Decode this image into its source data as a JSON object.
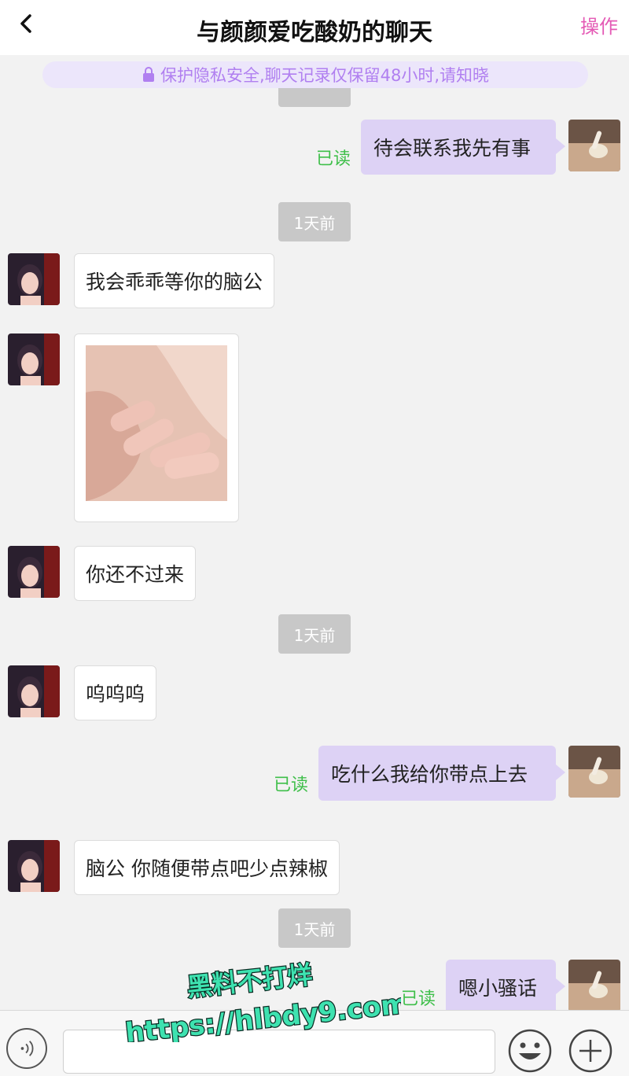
{
  "header": {
    "title": "与颜颜爱吃酸奶的聊天",
    "action_label": "操作"
  },
  "privacy_notice": "保护隐私安全,聊天记录仅保留48小时,请知晓",
  "messages": [
    {
      "side": "out",
      "text": "待会联系我先有事",
      "status": "已读"
    },
    {
      "time": "1天前"
    },
    {
      "side": "in",
      "text": "我会乖乖等你的脑公"
    },
    {
      "side": "in",
      "type": "image"
    },
    {
      "side": "in",
      "text": "你还不过来"
    },
    {
      "time": "1天前"
    },
    {
      "side": "in",
      "text": "呜呜呜"
    },
    {
      "side": "out",
      "text": "吃什么我给你带点上去",
      "status": "已读"
    },
    {
      "side": "in",
      "text": "脑公 你随便带点吧少点辣椒"
    },
    {
      "time": "1天前"
    },
    {
      "side": "out",
      "text": "嗯小骚话",
      "status": "已读"
    }
  ],
  "watermark": {
    "line1": "黑料不打烊",
    "line2": "https://hlbdy9.com"
  },
  "colors": {
    "accent": "#e45ab5",
    "outgoing_bubble": "#ddd2f5",
    "read_status": "#3fbf4a",
    "banner_bg": "#ece6fb"
  },
  "icons": {
    "back": "chevron-left-icon",
    "lock": "lock-icon",
    "voice": "voice-icon",
    "emoji": "emoji-icon",
    "more": "plus-icon"
  }
}
